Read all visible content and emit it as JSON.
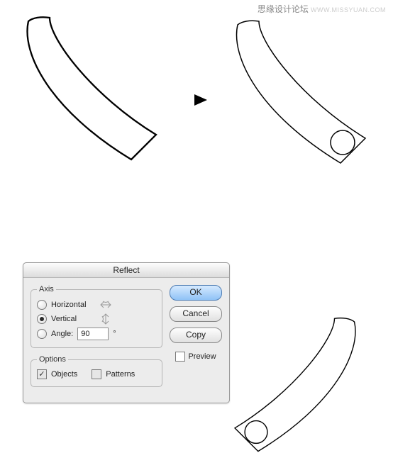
{
  "watermark": {
    "main": "思缘设计论坛",
    "url": "WWW.MISSYUAN.COM"
  },
  "dialog": {
    "title": "Reflect",
    "axis_legend": "Axis",
    "horizontal_label": "Horizontal",
    "vertical_label": "Vertical",
    "angle_label": "Angle:",
    "angle_value": "90",
    "deg_symbol": "°",
    "options_legend": "Options",
    "objects_label": "Objects",
    "patterns_label": "Patterns",
    "ok_label": "OK",
    "cancel_label": "Cancel",
    "copy_label": "Copy",
    "preview_label": "Preview"
  }
}
